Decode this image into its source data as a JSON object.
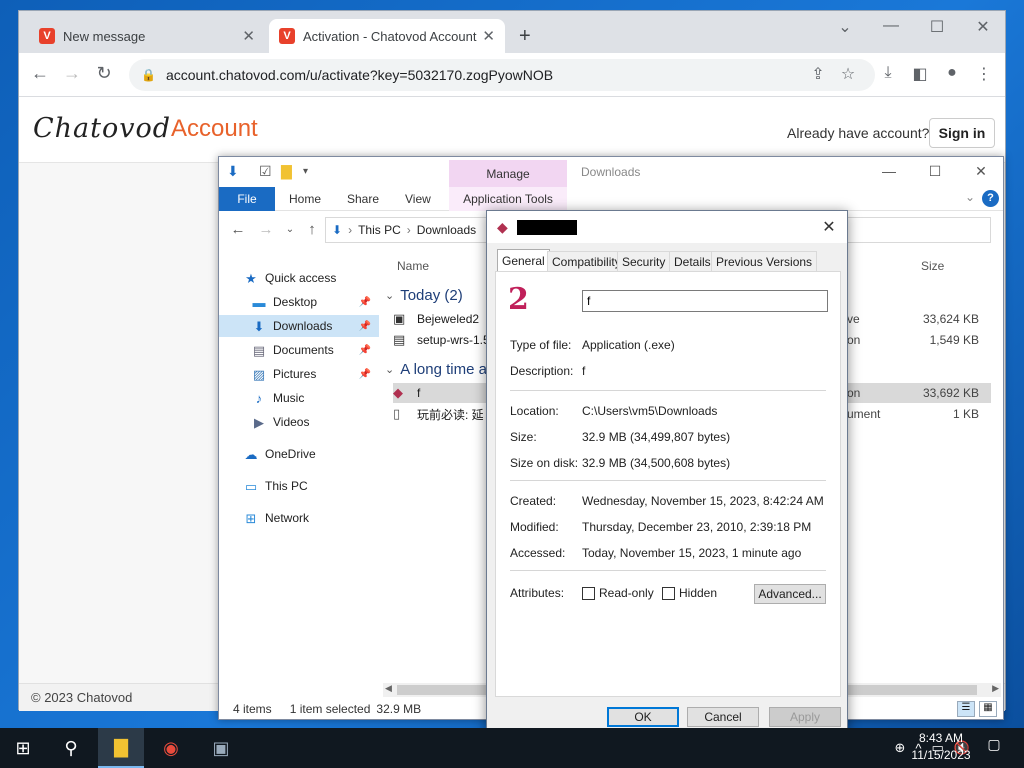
{
  "browser": {
    "tabs": [
      {
        "label": "New message",
        "active": false
      },
      {
        "label": "Activation - Chatovod Account",
        "active": true
      }
    ],
    "favicon_glyph": "V",
    "url": "account.chatovod.com/u/activate?key=5032170.zogPyowNOB"
  },
  "page": {
    "logo": "Chatovod",
    "logo_suffix": "Account",
    "already_text": "Already have account?",
    "signin_label": "Sign in",
    "footer": "© 2023 Chatovod",
    "accent_color": "#e8622b"
  },
  "explorer": {
    "manage_label": "Manage",
    "title": "Downloads",
    "ribbon_tabs": [
      "File",
      "Home",
      "Share",
      "View",
      "Application Tools"
    ],
    "breadcrumb": [
      "This PC",
      "Downloads"
    ],
    "nav": {
      "quick_access": "Quick access",
      "desktop": "Desktop",
      "downloads": "Downloads",
      "documents": "Documents",
      "pictures": "Pictures",
      "music": "Music",
      "videos": "Videos",
      "onedrive": "OneDrive",
      "thispc": "This PC",
      "network": "Network"
    },
    "columns": {
      "name": "Name",
      "size": "Size"
    },
    "groups": {
      "today": "Today (2)",
      "longago": "A long time a"
    },
    "files": [
      {
        "name": "Bejeweled2",
        "type": "ve",
        "size": "33,624 KB"
      },
      {
        "name": "setup-wrs-1.5",
        "type": "on",
        "size": "1,549 KB"
      },
      {
        "name": "f",
        "type": "on",
        "size": "33,692 KB"
      },
      {
        "name": "玩前必读: 延",
        "type": "ument",
        "size": "1 KB"
      }
    ],
    "status": {
      "items": "4 items",
      "selected": "1 item selected",
      "size": "32.9 MB"
    }
  },
  "props": {
    "tabs": [
      "General",
      "Compatibility",
      "Security",
      "Details",
      "Previous Versions"
    ],
    "name_value": "f",
    "rows": {
      "type_label": "Type of file:",
      "type_value": "Application (.exe)",
      "desc_label": "Description:",
      "desc_value": "f",
      "loc_label": "Location:",
      "loc_value": "C:\\Users\\vm5\\Downloads",
      "size_label": "Size:",
      "size_value": "32.9 MB (34,499,807 bytes)",
      "disk_label": "Size on disk:",
      "disk_value": "32.9 MB (34,500,608 bytes)",
      "created_label": "Created:",
      "created_value": "Wednesday, November 15, 2023, 8:42:24 AM",
      "modified_label": "Modified:",
      "modified_value": "Thursday, December 23, 2010, 2:39:18 PM",
      "accessed_label": "Accessed:",
      "accessed_value": "Today, November 15, 2023, 1 minute ago",
      "attr_label": "Attributes:"
    },
    "readonly_label": "Read-only",
    "hidden_label": "Hidden",
    "advanced_label": "Advanced...",
    "ok_label": "OK",
    "cancel_label": "Cancel",
    "apply_label": "Apply"
  },
  "taskbar": {
    "time": "8:43 AM",
    "date": "11/15/2023"
  }
}
